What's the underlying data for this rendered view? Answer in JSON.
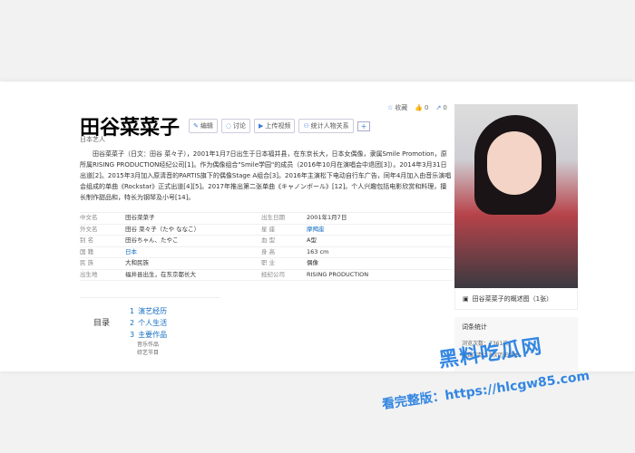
{
  "page": {
    "title": "田谷菜菜子",
    "actions": {
      "collect": "收藏",
      "likes": "0",
      "shares": "0"
    },
    "tags": [
      "编辑",
      "讨论",
      "上传视频",
      "统计人物关系"
    ],
    "subtitle": "日本艺人",
    "summary": "田谷菜菜子（日文：田谷 菜々子），2001年1月7日出生于日本福井县，在东京长大，日本女偶像，隶属Smile Promotion，原所属RISING PRODUCTION经纪公司[1]。作为偶像组合\"Smile学园\"的成员（2016年10月在演唱会中退团[3]）。2014年3月31日出道[2]。2015年3月加入原清音的PARTIS旗下的偶像Stage A组合[3]。2016年主演松下电动自行车广告，同年4月加入由音乐演唱会组成的单曲《Rockstar》正式出道[4][5]。2017年推出第二张单曲《キャノンボール》[12]。个人兴趣包括电影欣赏和料理，擅长制作甜品和，特长为钢琴及小号[14]。"
  },
  "infobox": {
    "rows": [
      {
        "l1": "中文名",
        "v1": "田谷菜菜子",
        "l2": "出生日期",
        "v2": "2001年1月7日"
      },
      {
        "l1": "外文名",
        "v1": "田谷 菜々子（たや ななこ）",
        "l2": "星 座",
        "v2": "摩羯座"
      },
      {
        "l1": "别 名",
        "v1": "田谷ちゃん、たやこ",
        "l2": "血 型",
        "v2": "A型"
      },
      {
        "l1": "国 籍",
        "v1": "日本",
        "l2": "身 高",
        "v2": "163 cm"
      },
      {
        "l1": "民 族",
        "v1": "大和民族",
        "l2": "职 业",
        "v2": "偶像"
      },
      {
        "l1": "出生地",
        "v1": "福井县出生，在东京都长大",
        "l2": "经纪公司",
        "v2": "RISING PRODUCTION"
      }
    ]
  },
  "toc": {
    "title": "目录",
    "items": [
      {
        "num": "1",
        "label": "演艺经历"
      },
      {
        "num": "2",
        "label": "个人生活"
      },
      {
        "num": "3",
        "label": "主要作品"
      }
    ],
    "subitems": [
      "音乐作品",
      "综艺节目"
    ]
  },
  "sidebar": {
    "caption": "田谷菜菜子的概述图（1张）",
    "stats_title": "词条统计",
    "browse": "浏览次数：7361次",
    "edits": "编辑次数：8次历史版本"
  },
  "watermark": {
    "line1": "黑料吃瓜网",
    "line2": "看完整版：https://hlcgw85.com"
  }
}
